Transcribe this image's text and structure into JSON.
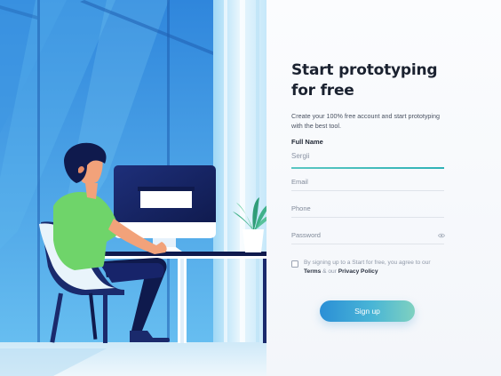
{
  "signup_form": {
    "title_line1": "Start prototyping",
    "title_line2": "for free",
    "subtitle_line1": "Create your 100% free account and start prototyping",
    "subtitle_line2": "with the best tool.",
    "full_name": {
      "label": "Full Name",
      "value": "Sergii"
    },
    "email": {
      "placeholder": "Email"
    },
    "phone": {
      "placeholder": "Phone"
    },
    "password": {
      "placeholder": "Password"
    },
    "consent": {
      "prefix": "By signing up to a Start for free, you agree to our",
      "terms": "Terms",
      "and": "& our",
      "privacy": "Privacy Policy",
      "checked": false
    },
    "submit_label": "Sign up"
  },
  "colors": {
    "accent_teal": "#3ab7b8",
    "button_gradient_start": "#2b8fd6",
    "button_gradient_end": "#7fd1c0",
    "illustration_blue": "#4aa9ea",
    "title_text": "#1b2230"
  },
  "icons": {
    "password_toggle": "eye-icon"
  }
}
